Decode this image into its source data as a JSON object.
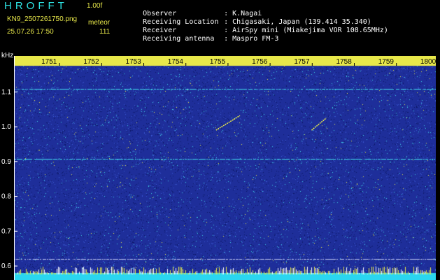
{
  "header": {
    "app_title": "HROFFT",
    "version": "1.00f",
    "filename": "KN9_2507261750.png",
    "mode": "meteor",
    "datetime": "25.07.26 17:50",
    "count": "111"
  },
  "info": [
    {
      "label": "Observer",
      "value": ": K.Nagai"
    },
    {
      "label": "Receiving Location",
      "value": ": Chigasaki, Japan (139.414 35.340)"
    },
    {
      "label": "Receiver",
      "value": ": AirSpy mini (Miakejima VOR 108.65MHz)"
    },
    {
      "label": "Receiving antenna",
      "value": ": Maspro FM-3"
    }
  ],
  "colors": {
    "background": "#000000",
    "spectrogram_base": "#1e2e9a",
    "noise_cyan": "#3fd2e8",
    "noise_yellow": "#e8e84a",
    "time_bar": "#e8e84a",
    "bottom_bar": "#2ad6f0",
    "title_cyan": "#2ee6e6"
  },
  "chart_data": {
    "type": "heatmap",
    "title": "",
    "ylabel": "kHz",
    "xlabel": "",
    "x_ticks": [
      "1751",
      "1752",
      "1753",
      "1754",
      "1755",
      "1756",
      "1757",
      "1758",
      "1759",
      "1800"
    ],
    "y_ticks": [
      "1.1",
      "1.0",
      "0.9",
      "0.8",
      "0.7",
      "0.6"
    ],
    "ylim": [
      0.58,
      1.175
    ],
    "xlim_minutes": [
      0,
      10
    ],
    "carrier_lines_khz": [
      1.108,
      0.908,
      0.62
    ],
    "meteor_traces": [
      {
        "x_start_min": 4.78,
        "y_start_khz": 0.99,
        "x_end_min": 5.35,
        "y_end_khz": 1.032
      },
      {
        "x_start_min": 7.05,
        "y_start_khz": 0.99,
        "x_end_min": 7.4,
        "y_end_khz": 1.025
      }
    ]
  }
}
